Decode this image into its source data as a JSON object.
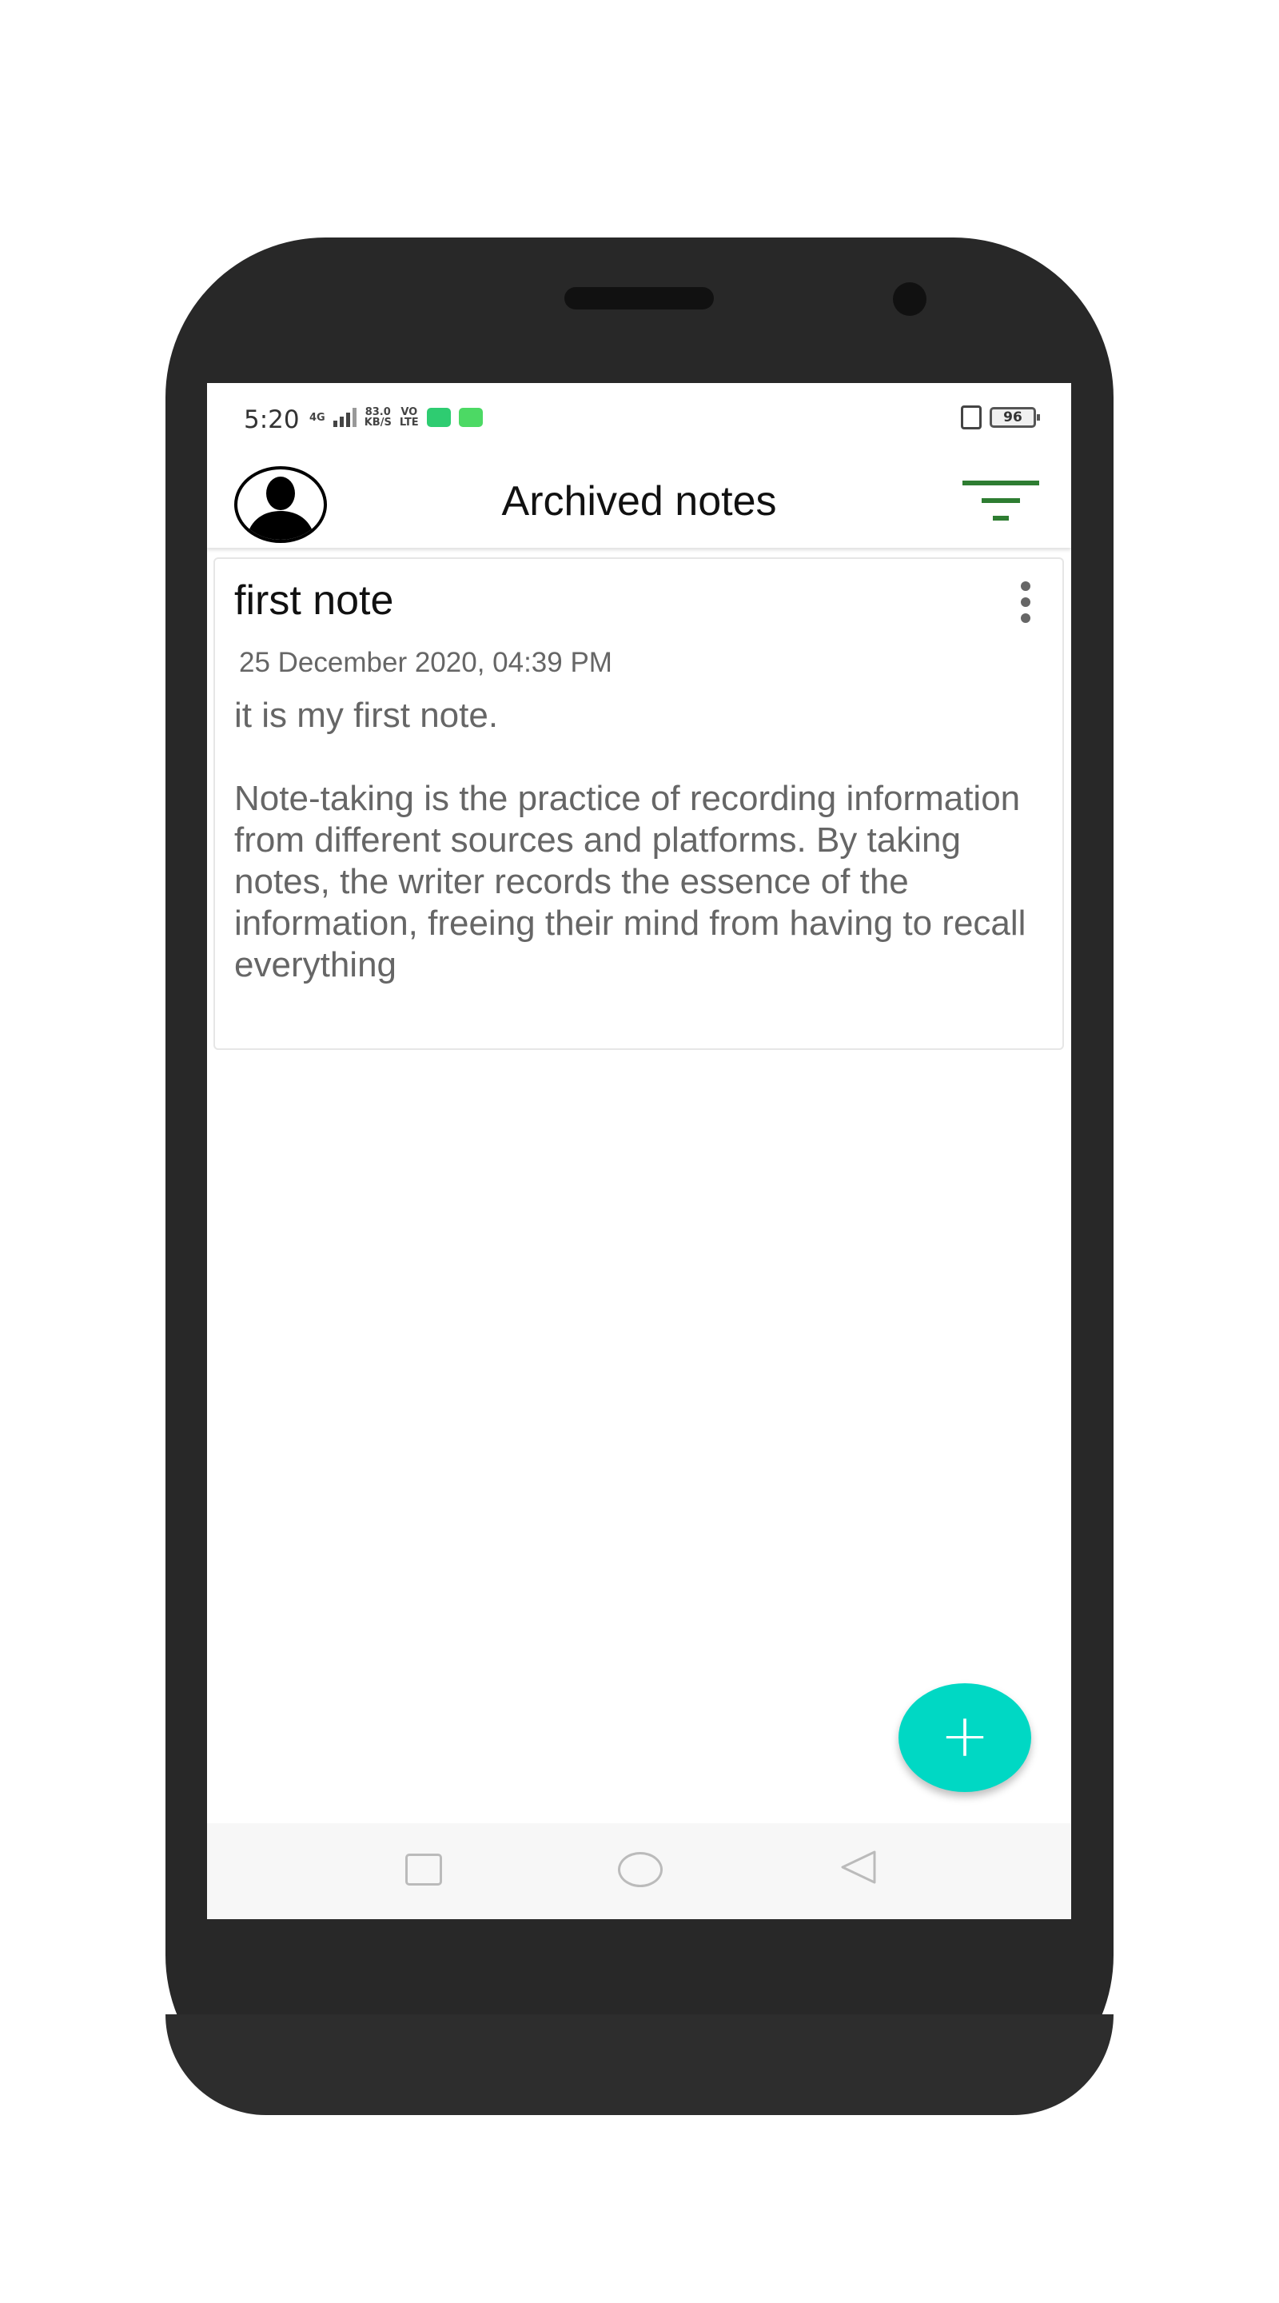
{
  "status_bar": {
    "time": "5:20",
    "network_type": "4G",
    "data_speed_value": "83.0",
    "data_speed_unit": "KB/S",
    "volte_top": "VO",
    "volte_bottom": "LTE",
    "battery_level": "96",
    "badge_colors": [
      "#2ecc71",
      "#4cd964"
    ]
  },
  "app_bar": {
    "title": "Archived notes",
    "accent_color": "#2e7d32"
  },
  "notes": [
    {
      "title": "first note",
      "timestamp": "25 December 2020, 04:39 PM",
      "body": "it is my first note.\n\nNote-taking is the practice of recording information from different sources and platforms. By taking notes, the writer records the essence of the information, freeing their mind from having to recall everything"
    }
  ],
  "fab": {
    "symbol": "+",
    "color": "#00d8c4"
  },
  "nav_bar": {
    "icons": [
      "recents-icon",
      "home-icon",
      "back-icon"
    ]
  }
}
